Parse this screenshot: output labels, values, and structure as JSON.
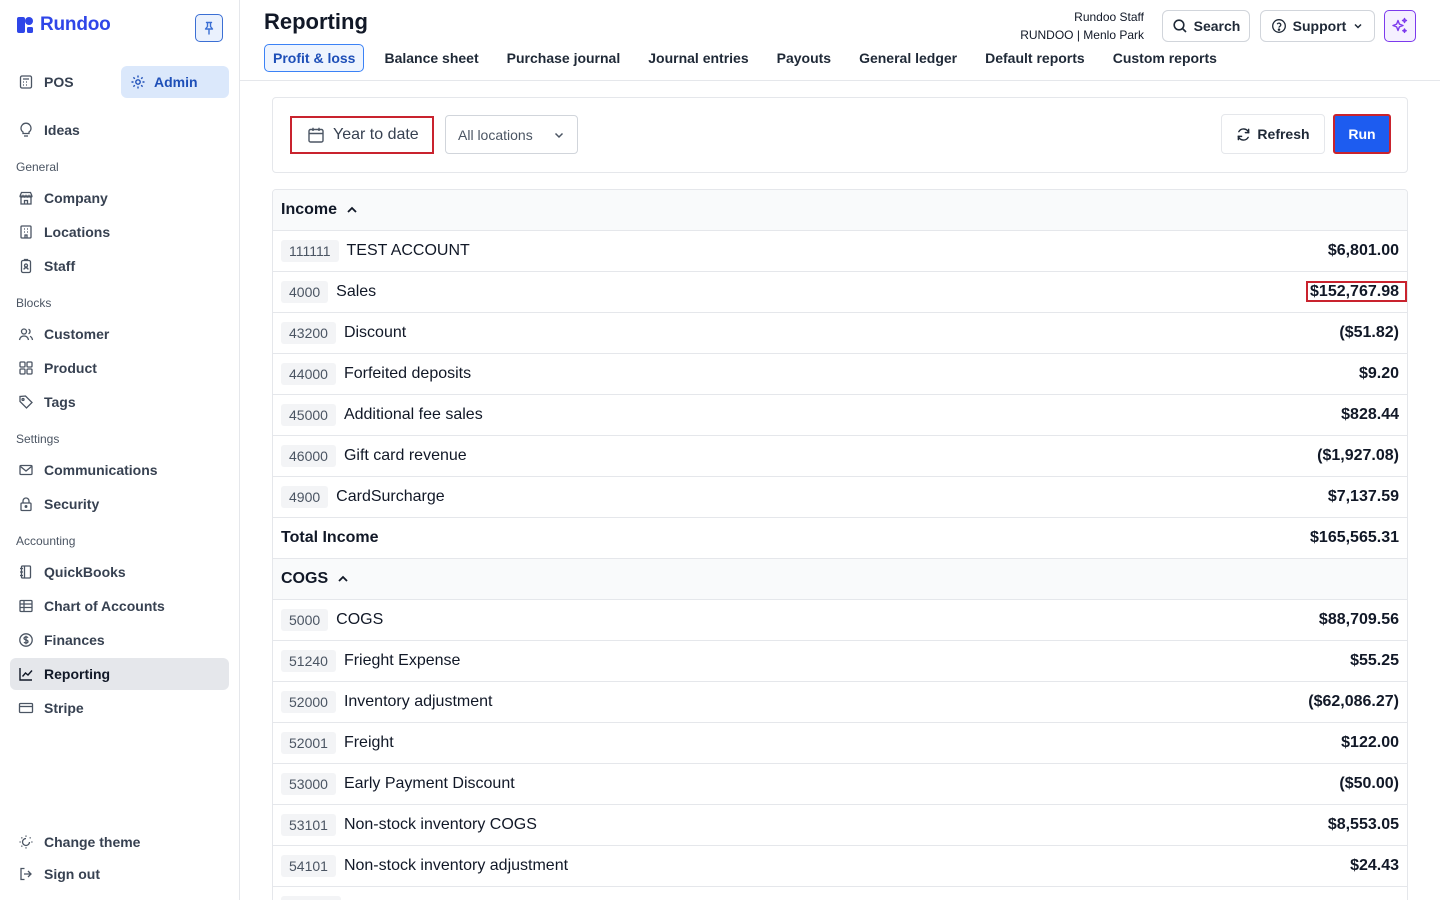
{
  "app": {
    "name": "Rundoo"
  },
  "sidebar": {
    "modes": {
      "pos_label": "POS",
      "admin_label": "Admin"
    },
    "ideas_label": "Ideas",
    "sections": {
      "general": "General",
      "blocks": "Blocks",
      "settings": "Settings",
      "accounting": "Accounting"
    },
    "items": {
      "company": "Company",
      "locations": "Locations",
      "staff": "Staff",
      "customer": "Customer",
      "product": "Product",
      "tags": "Tags",
      "communications": "Communications",
      "security": "Security",
      "quickbooks": "QuickBooks",
      "chart_of_accounts": "Chart of Accounts",
      "finances": "Finances",
      "reporting": "Reporting",
      "stripe": "Stripe"
    },
    "footer": {
      "change_theme": "Change theme",
      "sign_out": "Sign out"
    }
  },
  "header": {
    "title": "Reporting",
    "tabs": [
      "Profit & loss",
      "Balance sheet",
      "Purchase journal",
      "Journal entries",
      "Payouts",
      "General ledger",
      "Default reports",
      "Custom reports"
    ],
    "active_tab": "Profit & loss",
    "user_name": "Rundoo Staff",
    "user_org": "RUNDOO | Menlo Park",
    "search_label": "Search",
    "support_label": "Support"
  },
  "filters": {
    "date_range": "Year to date",
    "location": "All locations",
    "refresh_label": "Refresh",
    "run_label": "Run"
  },
  "report": {
    "income": {
      "title": "Income",
      "rows": [
        {
          "code": "111111",
          "name": "TEST ACCOUNT",
          "amount": "$6,801.00"
        },
        {
          "code": "4000",
          "name": "Sales",
          "amount": "$152,767.98"
        },
        {
          "code": "43200",
          "name": "Discount",
          "amount": "($51.82)"
        },
        {
          "code": "44000",
          "name": "Forfeited deposits",
          "amount": "$9.20"
        },
        {
          "code": "45000",
          "name": "Additional fee sales",
          "amount": "$828.44"
        },
        {
          "code": "46000",
          "name": "Gift card revenue",
          "amount": "($1,927.08)"
        },
        {
          "code": "4900",
          "name": "CardSurcharge",
          "amount": "$7,137.59"
        }
      ],
      "total_label": "Total Income",
      "total_amount": "$165,565.31"
    },
    "cogs": {
      "title": "COGS",
      "rows": [
        {
          "code": "5000",
          "name": "COGS",
          "amount": "$88,709.56"
        },
        {
          "code": "51240",
          "name": "Frieght Expense",
          "amount": "$55.25"
        },
        {
          "code": "52000",
          "name": "Inventory adjustment",
          "amount": "($62,086.27)"
        },
        {
          "code": "52001",
          "name": "Freight",
          "amount": "$122.00"
        },
        {
          "code": "53000",
          "name": "Early Payment Discount",
          "amount": "($50.00)"
        },
        {
          "code": "53101",
          "name": "Non-stock inventory COGS",
          "amount": "$8,553.05"
        },
        {
          "code": "54101",
          "name": "Non-stock inventory adjustment",
          "amount": "$24.43"
        }
      ]
    }
  },
  "colors": {
    "brand": "#2f46e8",
    "primary_button": "#1d5cf0",
    "highlight_outline": "#c9232e",
    "active_nav_bg": "#e5e7eb"
  }
}
